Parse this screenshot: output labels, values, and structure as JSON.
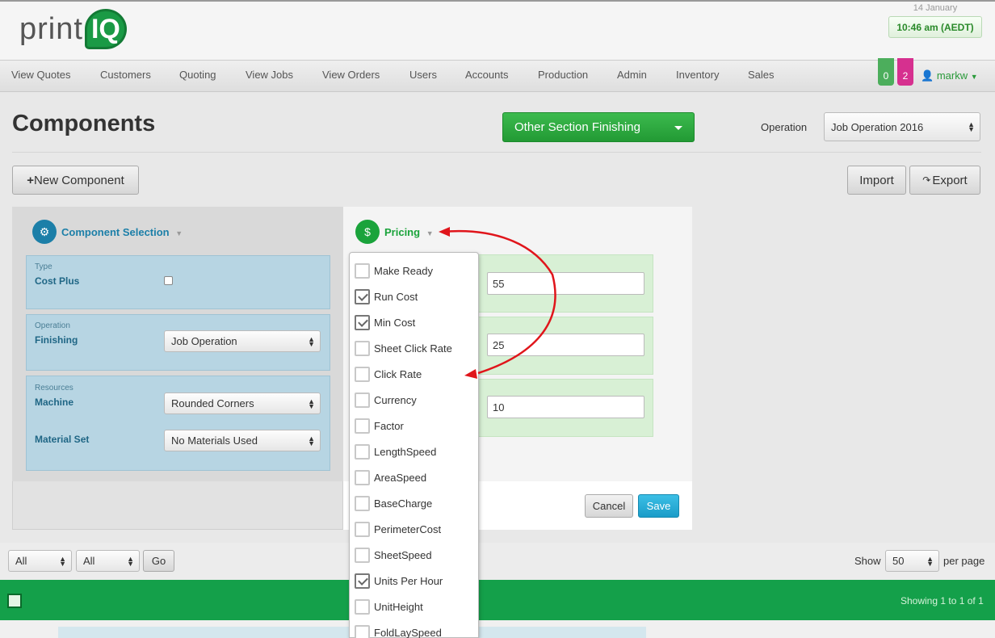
{
  "header": {
    "logo_text": "print",
    "logo_badge": "IQ",
    "date": "14 January",
    "time": "10:46 am (AEDT)"
  },
  "nav": {
    "items": [
      "View Quotes",
      "Customers",
      "Quoting",
      "View Jobs",
      "View Orders",
      "Users",
      "Accounts",
      "Production",
      "Admin",
      "Inventory",
      "Sales"
    ],
    "badge_green": "0",
    "badge_pink": "2",
    "user": "markw",
    "colors": {
      "green": "#4cae5c",
      "pink": "#d6308f"
    }
  },
  "page": {
    "title": "Components",
    "section_button": "Other Section Finishing",
    "operation_label": "Operation",
    "operation_value": "Job Operation 2016",
    "new_component": "New Component",
    "import": "Import",
    "export": "Export"
  },
  "component_selection": {
    "title": "Component Selection",
    "type_small": "Type",
    "type_label": "Cost Plus",
    "operation_small": "Operation",
    "operation_label": "Finishing",
    "operation_value": "Job Operation",
    "resources_small": "Resources",
    "machine_label": "Machine",
    "machine_value": "Rounded Corners",
    "material_label": "Material Set",
    "material_value": "No Materials Used"
  },
  "pricing": {
    "title": "Pricing",
    "fields": [
      "55",
      "25",
      "10"
    ],
    "cancel": "Cancel",
    "save": "Save",
    "menu": [
      {
        "label": "Make Ready",
        "checked": false
      },
      {
        "label": "Run Cost",
        "checked": true
      },
      {
        "label": "Min Cost",
        "checked": true
      },
      {
        "label": "Sheet Click Rate",
        "checked": false
      },
      {
        "label": "Click Rate",
        "checked": false
      },
      {
        "label": "Currency",
        "checked": false
      },
      {
        "label": "Factor",
        "checked": false
      },
      {
        "label": "LengthSpeed",
        "checked": false
      },
      {
        "label": "AreaSpeed",
        "checked": false
      },
      {
        "label": "BaseCharge",
        "checked": false
      },
      {
        "label": "PerimeterCost",
        "checked": false
      },
      {
        "label": "SheetSpeed",
        "checked": false
      },
      {
        "label": "Units Per Hour",
        "checked": true
      },
      {
        "label": "UnitHeight",
        "checked": false
      },
      {
        "label": "FoldLaySpeed",
        "checked": false
      }
    ]
  },
  "pager": {
    "filter1": "All",
    "filter2": "All",
    "go": "Go",
    "show_label": "Show",
    "page_size": "50",
    "per_page": "per page",
    "showing": "Showing 1 to 1 of 1"
  }
}
